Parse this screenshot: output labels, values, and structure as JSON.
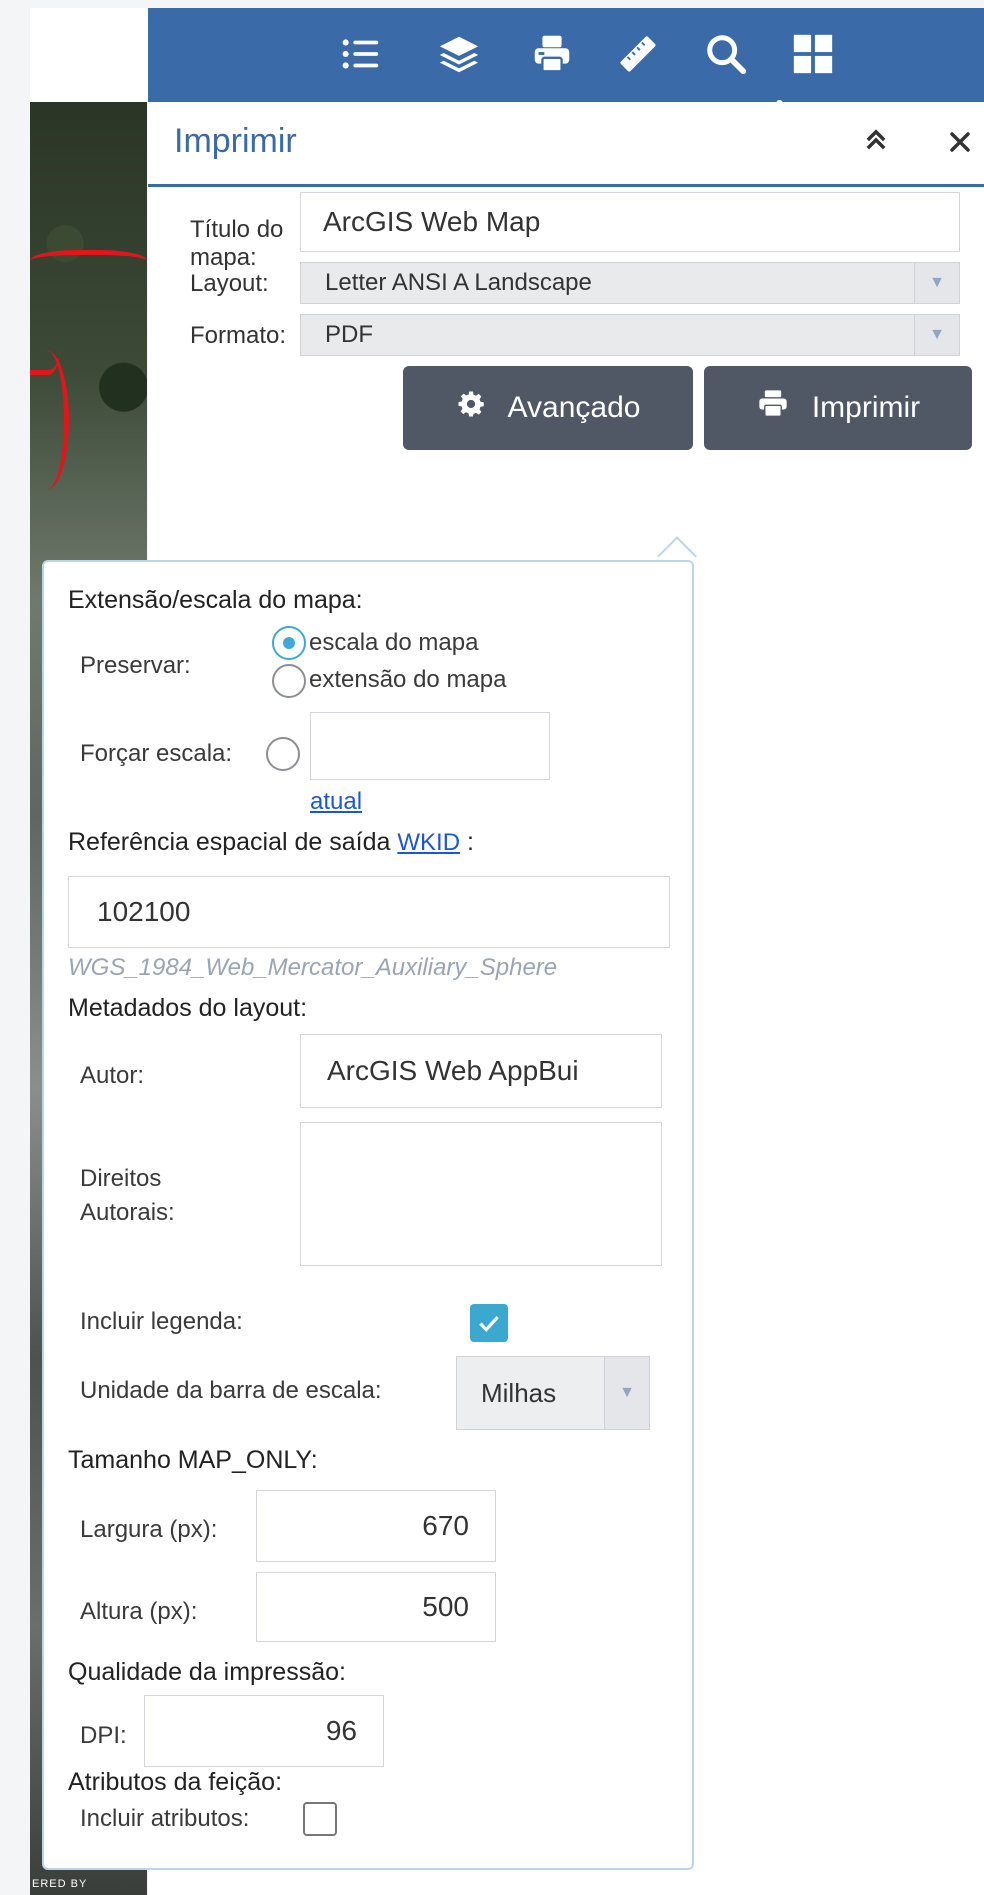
{
  "map": {
    "attribution": "ERED BY"
  },
  "toolbar": {
    "items": [
      {
        "name": "legend-list-icon"
      },
      {
        "name": "layers-icon"
      },
      {
        "name": "print-icon"
      },
      {
        "name": "measure-ruler-icon"
      },
      {
        "name": "search-icon"
      },
      {
        "name": "grid-icon"
      }
    ],
    "accent": "#3a6aa8"
  },
  "panel": {
    "title": "Imprimir",
    "collapse_glyph": "≈",
    "close_glyph": "×",
    "map_title_label": "Título do mapa:",
    "map_title_value": "ArcGIS Web Map",
    "layout_label": "Layout:",
    "layout_value": "Letter ANSI A Landscape",
    "format_label": "Formato:",
    "format_value": "PDF",
    "advanced_button": "Avançado",
    "print_button": "Imprimir"
  },
  "advanced": {
    "extent_heading": "Extensão/escala do mapa:",
    "preserve_label": "Preservar:",
    "option_scale": "escala do mapa",
    "option_extent": "extensão do mapa",
    "force_scale_label": "Forçar escala:",
    "force_scale_value": "",
    "current_link": "atual",
    "sr_heading": "Referência espacial de saída",
    "sr_link": "WKID",
    "sr_suffix": ":",
    "wkid_value": "102100",
    "wkid_name": "WGS_1984_Web_Mercator_Auxiliary_Sphere",
    "metadata_heading": "Metadados do layout:",
    "author_label": "Autor:",
    "author_value": "ArcGIS Web AppBui",
    "copyright_label": "Direitos Autorais:",
    "copyright_value": "",
    "legend_label": "Incluir legenda:",
    "legend_checked": true,
    "scalebar_label": "Unidade da barra de escala:",
    "scalebar_value": "Milhas",
    "mapsize_heading": "Tamanho MAP_ONLY:",
    "width_label": "Largura (px):",
    "width_value": "670",
    "height_label": "Altura (px):",
    "height_value": "500",
    "quality_heading": "Qualidade da impressão:",
    "dpi_label": "DPI:",
    "dpi_value": "96",
    "attrs_heading": "Atributos da feição:",
    "include_attrs_label": "Incluir atributos:",
    "include_attrs_checked": false
  }
}
